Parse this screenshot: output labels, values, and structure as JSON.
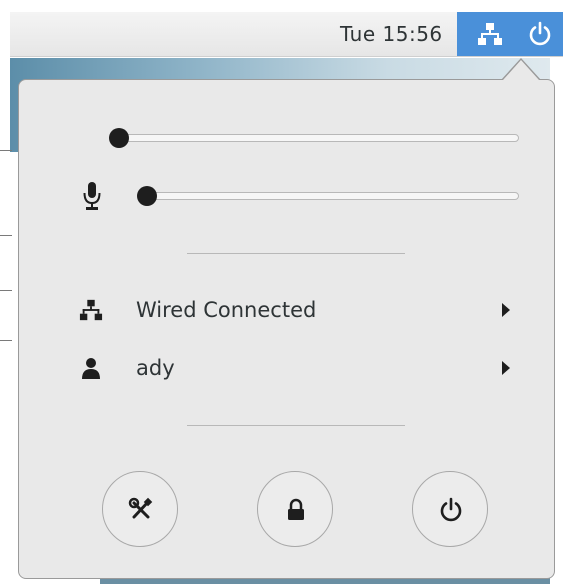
{
  "topbar": {
    "clock": "Tue 15:56",
    "status_icons": [
      "network-wired-icon",
      "power-icon"
    ]
  },
  "colors": {
    "accent": "#4a90d9",
    "menu_bg": "#e9e9e9",
    "text": "#2e3436"
  },
  "menu": {
    "volume_slider": {
      "icon": "",
      "level": 0.0
    },
    "mic_slider": {
      "icon": "microphone-icon",
      "level": 0.0
    },
    "rows": [
      {
        "icon": "network-wired-icon",
        "label": "Wired Connected"
      },
      {
        "icon": "user-icon",
        "label": "ady"
      }
    ],
    "buttons": [
      "settings-icon",
      "lock-icon",
      "power-icon"
    ]
  }
}
